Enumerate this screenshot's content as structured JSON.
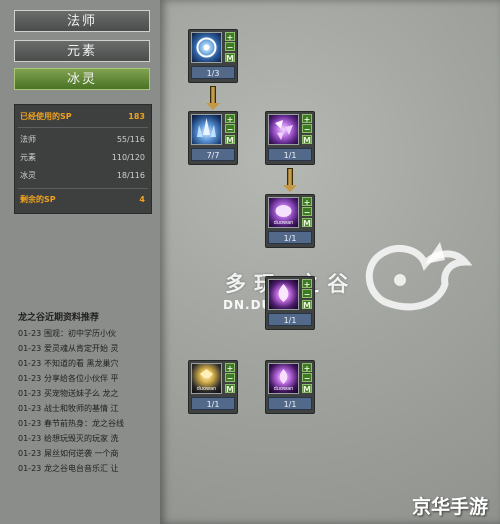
{
  "categories": [
    {
      "label": "法师",
      "active": false
    },
    {
      "label": "元素",
      "active": false
    },
    {
      "label": "冰灵",
      "active": true
    }
  ],
  "sp_summary": {
    "used_label": "已经使用的SP",
    "used_value": "183",
    "rows": [
      {
        "label": "法师",
        "value": "55/116"
      },
      {
        "label": "元素",
        "value": "110/120"
      },
      {
        "label": "冰灵",
        "value": "18/116"
      }
    ],
    "remaining_label": "剩余的SP",
    "remaining_value": "4"
  },
  "news": {
    "title": "龙之谷近期资料推荐",
    "items": [
      {
        "date": "01-23",
        "text": "围观：初中学历小伙"
      },
      {
        "date": "01-23",
        "text": "爱灵魂从肯定开始 灵"
      },
      {
        "date": "01-23",
        "text": "不知道的看 黑龙巢穴"
      },
      {
        "date": "01-23",
        "text": "分享给各位小伙伴 平"
      },
      {
        "date": "01-23",
        "text": "买宠物送妹子么 龙之"
      },
      {
        "date": "01-23",
        "text": "战士和牧师的基情 江"
      },
      {
        "date": "01-23",
        "text": "春节前热身：龙之谷线"
      },
      {
        "date": "01-23",
        "text": "给想玩毁灭的玩家 洗"
      },
      {
        "date": "01-23",
        "text": "屌丝如何逆袭 一个商"
      },
      {
        "date": "01-23",
        "text": "龙之谷电台音乐汇 让"
      }
    ]
  },
  "skills": [
    {
      "level": "1/3",
      "icon": "ice-orb-icon",
      "plus": "+",
      "minus": "−",
      "master": "M"
    },
    {
      "level": "7/7",
      "icon": "ice-spike-icon",
      "plus": "+",
      "minus": "−",
      "master": "M"
    },
    {
      "level": "1/1",
      "icon": "purple-shards-icon",
      "plus": "+",
      "minus": "−",
      "master": "M"
    },
    {
      "level": "1/1",
      "icon": "purple-mask-icon",
      "plus": "+",
      "minus": "−",
      "master": "M"
    },
    {
      "level": "1/1",
      "icon": "purple-flame-icon",
      "plus": "+",
      "minus": "−",
      "master": "M"
    },
    {
      "level": "1/1",
      "icon": "yellow-sigil-icon",
      "plus": "+",
      "minus": "−",
      "master": "M"
    },
    {
      "level": "1/1",
      "icon": "purple-flame-icon",
      "plus": "+",
      "minus": "−",
      "master": "M"
    }
  ],
  "watermark": {
    "big": "多玩    之谷",
    "small": "DN.DU         .COM"
  },
  "corner_brand": "京华手游",
  "colors": {
    "accent_green": "#5c8a30",
    "sp_orange": "#f0a21e",
    "level_bar": "#52698a"
  }
}
